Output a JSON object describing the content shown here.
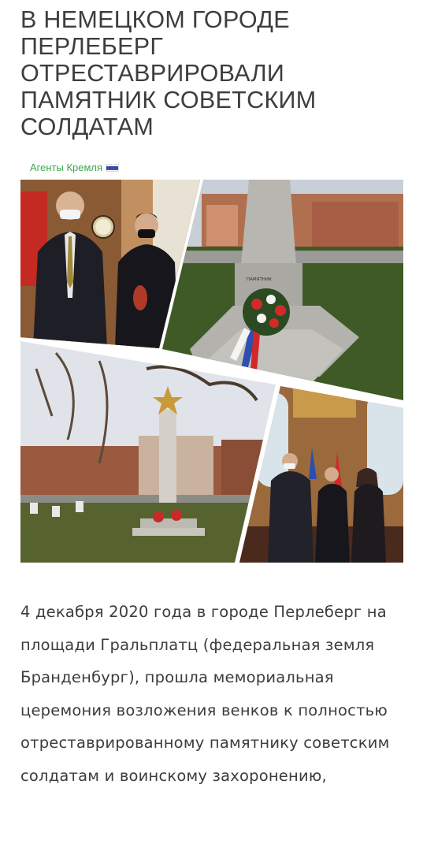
{
  "article": {
    "title": "В НЕМЕЦКОМ ГОРОДЕ ПЕРЛЕБЕРГ ОТРЕСТАВРИРОВАЛИ ПАМЯТНИК СОВЕТСКИМ СОЛДАТАМ",
    "source_label": "Агенты Кремля",
    "source_flag": "russia-flag-icon",
    "body": "4 декабря 2020 года в городе Перлеберг на площади Гральплатц (федеральная земля Бранденбург), прошла мемориальная церемония возложения венков к полностью отреставрированному памятнику советским солдатам и воинскому захоронению,"
  },
  "photos": [
    {
      "name": "photo-officials-indoors"
    },
    {
      "name": "photo-monument-wreath"
    },
    {
      "name": "photo-obelisk-square"
    },
    {
      "name": "photo-ceremony-hall"
    }
  ],
  "colors": {
    "source_green": "#3fa84a",
    "text": "#3c3c3c",
    "flag_white": "#ffffff",
    "flag_blue": "#1c4fb8",
    "flag_red": "#d52b1e"
  }
}
